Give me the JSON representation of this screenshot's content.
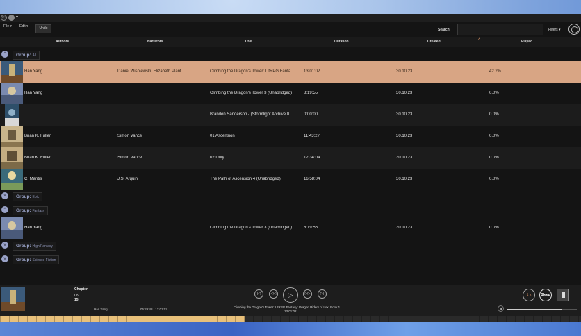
{
  "titlebar": {
    "icon_left": "⏮",
    "caret": "▾"
  },
  "menu": {
    "file": "File",
    "edit": "Edit",
    "undo": "Undo",
    "caret": "▾"
  },
  "search": {
    "label": "Search",
    "placeholder": ""
  },
  "filters": {
    "label": "Filters",
    "caret": "▾"
  },
  "columns": [
    "Authors",
    "Narrators",
    "Title",
    "Duration",
    "Created",
    "Played"
  ],
  "sort_indicator": "^",
  "groups": [
    {
      "label": "Group:",
      "value": "All",
      "chevron": "^"
    },
    {
      "label": "Group:",
      "value": "Epic",
      "chevron": "v"
    },
    {
      "label": "Group:",
      "value": "Fantasy",
      "chevron": "^"
    },
    {
      "label": "Group:",
      "value": "High Fantasy",
      "chevron": "v"
    },
    {
      "label": "Group:",
      "value": "Science Fiction",
      "chevron": "v"
    }
  ],
  "rows": [
    {
      "author": "Han Yang",
      "narrator": "Daniel Wisniewski, Elizabeth Plant",
      "title": "Climbing the Dragon's Tower: LitRPG Fanta...",
      "duration": "13:01:02",
      "created": "30.10.23",
      "played": "42.2%"
    },
    {
      "author": "Han Yang",
      "narrator": "",
      "title": "Climbing the Dragon's Tower 3 (Unabridged)",
      "duration": "8:19:55",
      "created": "30.10.23",
      "played": "0.0%"
    },
    {
      "author": "",
      "narrator": "",
      "title": "Brandon Sanderson - (Stormlight Archive 0...",
      "duration": "0:00:00",
      "created": "30.10.23",
      "played": "0.0%"
    },
    {
      "author": "Brian K. Fuller",
      "narrator": "Simon Vance",
      "title": "01 Ascension",
      "duration": "11:43:27",
      "created": "30.10.23",
      "played": "0.0%"
    },
    {
      "author": "Brian K. Fuller",
      "narrator": "Simon Vance",
      "title": "02 Duty",
      "duration": "12:34:04",
      "created": "30.10.23",
      "played": "0.0%"
    },
    {
      "author": "C. Mantis",
      "narrator": "J.S. Arquin",
      "title": "The Path of Ascension 4 (Unabridged)",
      "duration": "16:58:04",
      "created": "30.10.23",
      "played": "0.0%"
    },
    {
      "author": "Han Yang",
      "narrator": "",
      "title": "Climbing the Dragon's Tower 3 (Unabridged)",
      "duration": "8:19:55",
      "created": "30.10.23",
      "played": "0.0%"
    }
  ],
  "colors": {
    "selected_row": "#d8a584",
    "group_accent": "#9aa3c8",
    "progress": "#e8c07a",
    "sort_accent": "#e59a6a"
  },
  "player": {
    "chapter_label": "Chapter",
    "chapter_num": "0/9",
    "chapter_total": "15",
    "author": "Han Yang",
    "time": "05:29:48 / 13:01:02",
    "title": "Climbing the Dragon's Tower: LitRPG Fantasy: Dragon Riders of Lox, Book 1",
    "duration": "13:01:02",
    "speed": "1 x",
    "sleep": "Sleep",
    "progress_fraction": 0.422,
    "volume_fraction": 0.78,
    "controls": {
      "prev": "|◁",
      "rewind": "◁◁",
      "play": "▷",
      "forward": "▷▷",
      "next": "▷|"
    }
  }
}
